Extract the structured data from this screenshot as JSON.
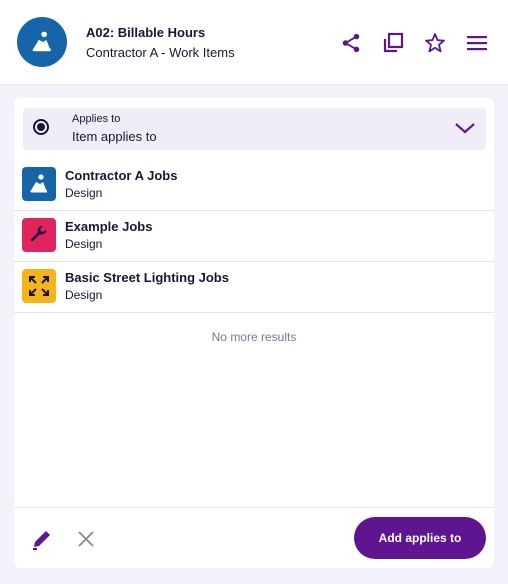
{
  "header": {
    "title": "A02: Billable Hours",
    "subtitle": "Contractor A - Work Items",
    "avatar_icon": "worker-icon",
    "actions": [
      "share-icon",
      "copy-icon",
      "star-icon",
      "menu-icon"
    ]
  },
  "applies_to": {
    "label": "Applies to",
    "value": "Item applies to"
  },
  "items": [
    {
      "title": "Contractor A Jobs",
      "subtitle": "Design",
      "icon": "worker-icon",
      "color": "#1565a8"
    },
    {
      "title": "Example Jobs",
      "subtitle": "Design",
      "icon": "wrench-icon",
      "color": "#e0245e"
    },
    {
      "title": "Basic Street Lighting Jobs",
      "subtitle": "Design",
      "icon": "expand-icon",
      "color": "#f4b41a"
    }
  ],
  "status": "No more results",
  "footer": {
    "add_label": "Add applies to"
  },
  "colors": {
    "accent": "#5f1590",
    "background": "#f3f1fa"
  }
}
